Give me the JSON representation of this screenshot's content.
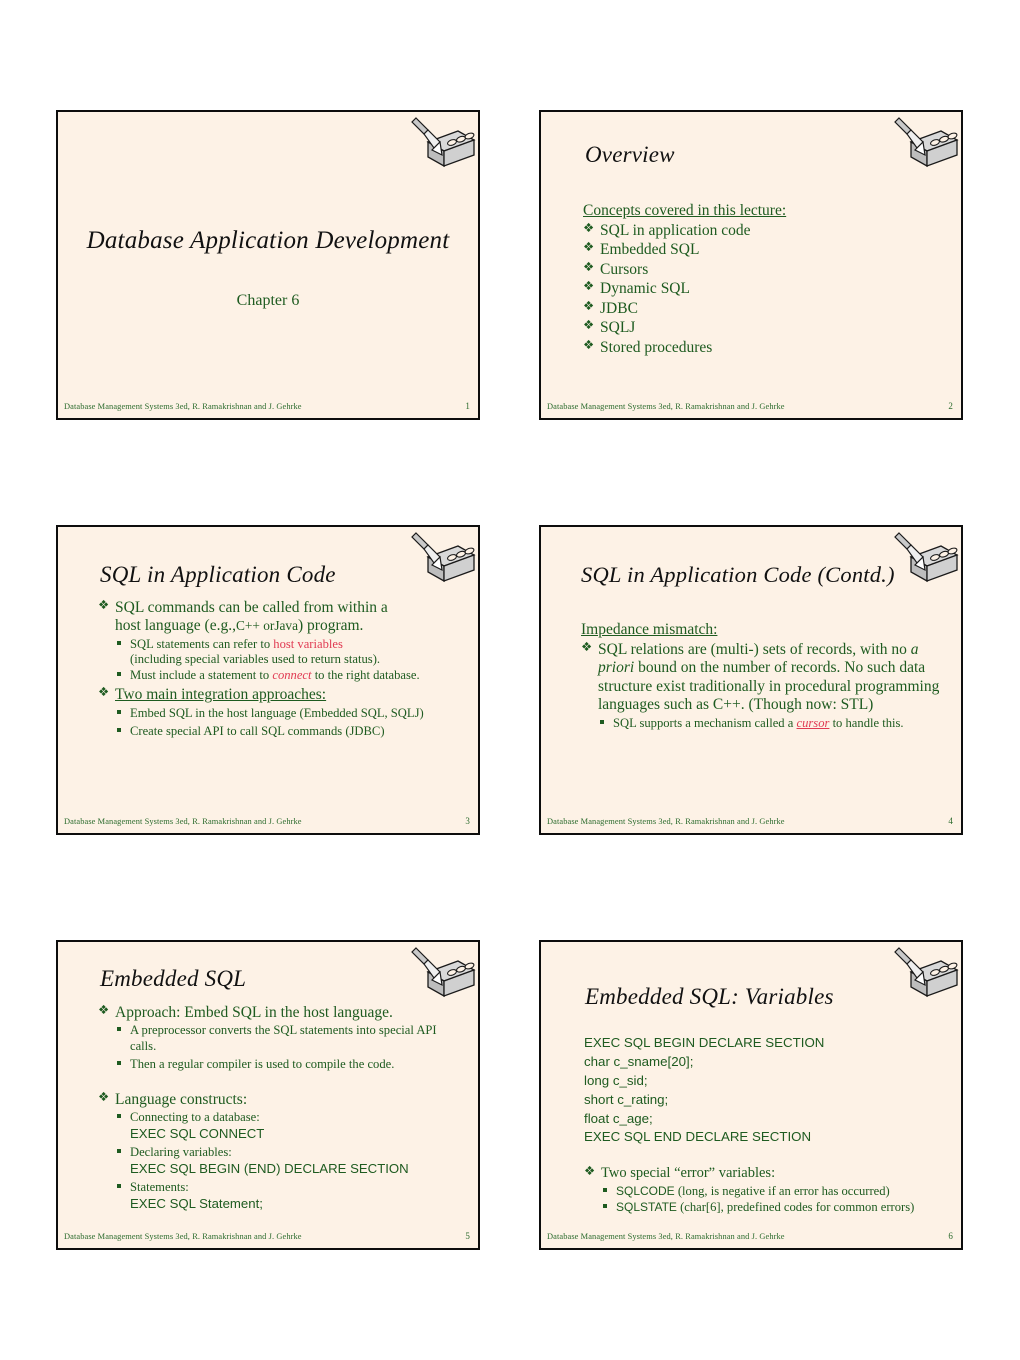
{
  "theme": {
    "slide_bg": "#fdf2e6",
    "border": "#0d0d0d",
    "body_green": "#1e5b20",
    "accent_red": "#e03a52",
    "title_black": "#111111"
  },
  "footer": {
    "credit": "Database Management Systems 3ed,  R. Ramakrishnan and J. Gehrke"
  },
  "slides": [
    {
      "number": "1",
      "title": "Database Application Development",
      "subtitle": "Chapter 6"
    },
    {
      "number": "2",
      "title": "Overview",
      "lead": "Concepts covered in this lecture:",
      "bullets": [
        "SQL in application code",
        "Embedded SQL",
        "Cursors",
        "Dynamic SQL",
        "JDBC",
        "SQLJ",
        "Stored procedures"
      ]
    },
    {
      "number": "3",
      "title": "SQL in Application Code",
      "b1_line1": "SQL commands can be called from within a",
      "b1_line2_a": "host language (e.g.,",
      "b1_line2_b": "C++ or",
      "b1_line2_c": "Java",
      "b1_line2_d": ") program.",
      "s1_a": "SQL statements can refer to",
      "s1_red": "host variables",
      "s1_b": "(including special variables used to return status).",
      "s2_a": "Must include a statement to",
      "s2_red": "connect",
      "s2_b": "to the right database.",
      "b2": "Two main integration approaches:",
      "s3": "Embed SQL in the host language (Embedded SQL, SQLJ)",
      "s4": "Create special API to call SQL commands (JDBC)"
    },
    {
      "number": "4",
      "title": "SQL in Application Code (Contd.)",
      "lead": "Impedance mismatch:",
      "b1_a": "SQL relations are (multi-) sets of records, with no",
      "b1_it": "a priori",
      "b1_b": "bound on the number of records. No such data structure exist traditionally in procedural programming languages such as C++.  (Though now: STL)",
      "s1_a": "SQL supports a mechanism called a",
      "s1_red": "cursor",
      "s1_b": "to handle this."
    },
    {
      "number": "5",
      "title": "Embedded SQL",
      "b1": "Approach: Embed SQL in the host language.",
      "s1": "A preprocessor converts the SQL statements into special API calls.",
      "s2": "Then a regular compiler is used to compile the code.",
      "b2": "Language constructs:",
      "s3_label": "Connecting to a database:",
      "s3_code": "EXEC SQL CONNECT",
      "s4_label": "Declaring variables:",
      "s4_code": "EXEC SQL BEGIN (END) DECLARE SECTION",
      "s5_label": "Statements:",
      "s5_code": "EXEC SQL Statement;"
    },
    {
      "number": "6",
      "title": "Embedded SQL: Variables",
      "code_lines": [
        "EXEC SQL BEGIN DECLARE SECTION",
        "char c_sname[20];",
        "long c_sid;",
        "short c_rating;",
        "float c_age;",
        "EXEC SQL END DECLARE SECTION"
      ],
      "b1": "Two special “error” variables:",
      "s1_code": "SQLCODE",
      "s1_text": "(long, is negative if an error has occurred)",
      "s2_code": "SQLSTATE",
      "s2_text": "(char[6], predefined codes for common errors)"
    }
  ],
  "icons": {
    "logo": "pencil-eraser-block-icon",
    "bullet_level1": "diamond-bullet-icon",
    "bullet_level2": "square-bullet-icon"
  }
}
